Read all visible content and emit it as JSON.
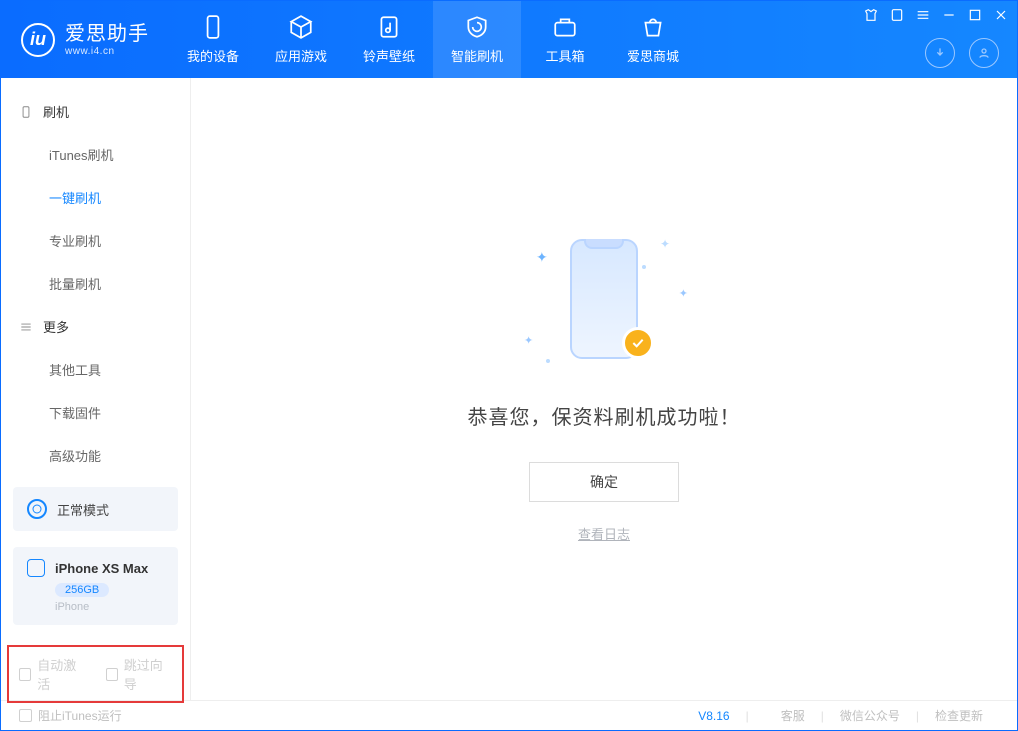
{
  "app": {
    "name": "爱思助手",
    "url": "www.i4.cn"
  },
  "tabs": [
    {
      "label": "我的设备"
    },
    {
      "label": "应用游戏"
    },
    {
      "label": "铃声壁纸"
    },
    {
      "label": "智能刷机"
    },
    {
      "label": "工具箱"
    },
    {
      "label": "爱思商城"
    }
  ],
  "sidebar": {
    "group1_title": "刷机",
    "group1_items": [
      {
        "label": "iTunes刷机"
      },
      {
        "label": "一键刷机"
      },
      {
        "label": "专业刷机"
      },
      {
        "label": "批量刷机"
      }
    ],
    "group2_title": "更多",
    "group2_items": [
      {
        "label": "其他工具"
      },
      {
        "label": "下载固件"
      },
      {
        "label": "高级功能"
      }
    ]
  },
  "mode": {
    "label": "正常模式"
  },
  "device": {
    "name": "iPhone XS Max",
    "capacity": "256GB",
    "type": "iPhone"
  },
  "options": {
    "auto_activate": "自动激活",
    "skip_guide": "跳过向导"
  },
  "main": {
    "message": "恭喜您，保资料刷机成功啦！",
    "ok_label": "确定",
    "log_link": "查看日志"
  },
  "footer": {
    "block_itunes": "阻止iTunes运行",
    "version": "V8.16",
    "links": {
      "support": "客服",
      "wechat": "微信公众号",
      "update": "检查更新"
    }
  }
}
